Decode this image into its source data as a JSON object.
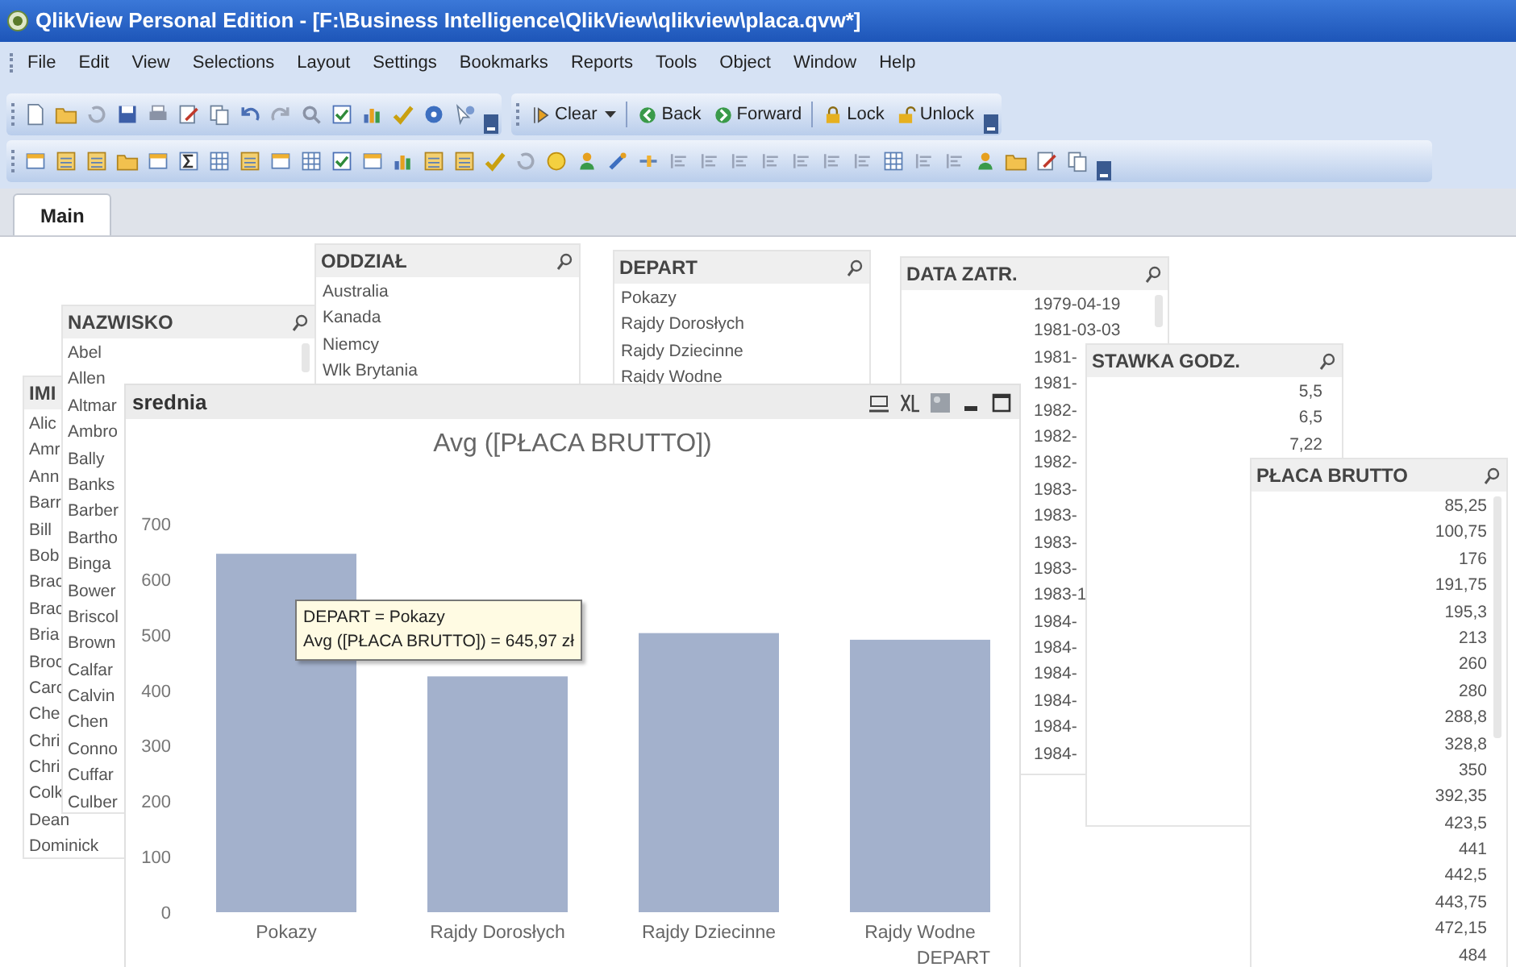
{
  "window": {
    "title": "QlikView Personal Edition - [F:\\Business Intelligence\\QlikView\\qlikview\\placa.qvw*]"
  },
  "menu": [
    "File",
    "Edit",
    "View",
    "Selections",
    "Layout",
    "Settings",
    "Bookmarks",
    "Reports",
    "Tools",
    "Object",
    "Window",
    "Help"
  ],
  "toolbar_buttons": [
    {
      "kind": "clear",
      "label": "Clear"
    },
    {
      "kind": "back",
      "label": "Back"
    },
    {
      "kind": "forward",
      "label": "Forward"
    },
    {
      "kind": "lock",
      "label": "Lock"
    },
    {
      "kind": "unlock",
      "label": "Unlock"
    }
  ],
  "sheet_tabs": [
    {
      "label": "Main",
      "selected": true
    }
  ],
  "list_boxes": [
    {
      "title": "IMI",
      "items": [
        "Alic",
        "Amr",
        "Ann",
        "Barr",
        "Bill",
        "Bob",
        "Brac",
        "Brac",
        "Bria",
        "Broc",
        "Carc",
        "Che",
        "Chri",
        "Chri",
        "Colk",
        "Dean",
        "Dominick"
      ]
    },
    {
      "title": "NAZWISKO",
      "items": [
        "Abel",
        "Allen",
        "Altmar",
        "Ambro",
        "Bally",
        "Banks",
        "Barber",
        "Bartho",
        "Binga",
        "Bower",
        "Briscol",
        "Brown",
        "Calfar",
        "Calvin",
        "Chen",
        "Conno",
        "Cuffar",
        "Culber"
      ]
    },
    {
      "title": "ODDZIAŁ",
      "items": [
        "Australia",
        "Kanada",
        "Niemcy",
        "Wlk Brytania"
      ]
    },
    {
      "title": "DEPART",
      "items": [
        "Pokazy",
        "Rajdy Dorosłych",
        "Rajdy Dziecinne",
        "Rajdy Wodne"
      ]
    },
    {
      "title": "DATA ZATR.",
      "items": [
        "1979-04-19",
        "1981-03-03",
        "1981-",
        "1981-",
        "1982-",
        "1982-",
        "1982-",
        "1983-",
        "1983-",
        "1983-",
        "1983-",
        "1983-1",
        "1984-",
        "1984-",
        "1984-",
        "1984-",
        "1984-",
        "1984-"
      ]
    },
    {
      "title": "STAWKA GODZ.",
      "items": [
        "5,5",
        "6,5",
        "7,22"
      ]
    },
    {
      "title": "PŁACA BRUTTO",
      "items": [
        "85,25",
        "100,75",
        "176",
        "191,75",
        "195,3",
        "213",
        "260",
        "280",
        "288,8",
        "328,8",
        "350",
        "392,35",
        "423,5",
        "441",
        "442,5",
        "443,75",
        "472,15",
        "484"
      ]
    }
  ],
  "chart_object": {
    "caption": "srednia",
    "chart_data": {
      "type": "bar",
      "title": "Avg ([PŁACA BRUTTO])",
      "xlabel": "DEPART",
      "categories": [
        "Pokazy",
        "Rajdy Dorosłych",
        "Rajdy Dziecinne",
        "Rajdy Wodne"
      ],
      "series": [
        {
          "color": "#a3b1cc",
          "values": [
            646,
            425,
            503,
            491
          ]
        }
      ],
      "ylim": [
        0,
        700
      ],
      "yticks": [
        0,
        100,
        200,
        300,
        400,
        500,
        600,
        700
      ]
    },
    "tooltip": [
      "DEPART = Pokazy",
      "Avg ([PŁACA BRUTTO]) = 645,97 zł"
    ]
  }
}
